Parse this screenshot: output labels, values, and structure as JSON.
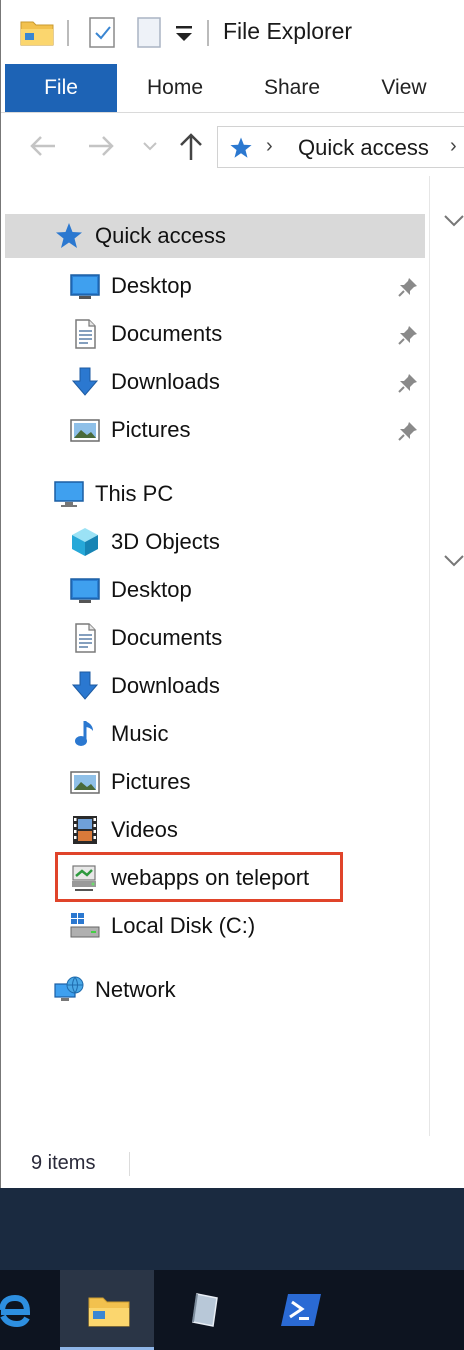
{
  "window": {
    "title": "File Explorer"
  },
  "ribbon": {
    "tabs": [
      {
        "label": "File",
        "active": true
      },
      {
        "label": "Home"
      },
      {
        "label": "Share"
      },
      {
        "label": "View"
      }
    ]
  },
  "address_bar": {
    "location": "Quick access"
  },
  "nav_pane": {
    "quick_access": {
      "label": "Quick access",
      "items": [
        {
          "label": "Desktop",
          "icon": "desktop-icon",
          "pinned": true
        },
        {
          "label": "Documents",
          "icon": "documents-icon",
          "pinned": true
        },
        {
          "label": "Downloads",
          "icon": "downloads-icon",
          "pinned": true
        },
        {
          "label": "Pictures",
          "icon": "pictures-icon",
          "pinned": true
        }
      ]
    },
    "this_pc": {
      "label": "This PC",
      "items": [
        {
          "label": "3D Objects",
          "icon": "3d-objects-icon"
        },
        {
          "label": "Desktop",
          "icon": "desktop-icon"
        },
        {
          "label": "Documents",
          "icon": "documents-icon"
        },
        {
          "label": "Downloads",
          "icon": "downloads-icon"
        },
        {
          "label": "Music",
          "icon": "music-icon"
        },
        {
          "label": "Pictures",
          "icon": "pictures-icon"
        },
        {
          "label": "Videos",
          "icon": "videos-icon"
        },
        {
          "label": "webapps on teleport",
          "icon": "network-drive-icon",
          "highlighted": true
        },
        {
          "label": "Local Disk (C:)",
          "icon": "local-disk-icon"
        }
      ]
    },
    "network": {
      "label": "Network",
      "icon": "network-icon"
    }
  },
  "status_bar": {
    "item_count": "9 items"
  },
  "taskbar": {
    "apps": [
      {
        "icon": "internet-explorer-icon"
      },
      {
        "icon": "file-explorer-icon",
        "active": true
      },
      {
        "icon": "server-manager-icon"
      },
      {
        "icon": "powershell-icon"
      }
    ]
  },
  "colors": {
    "file_tab": "#1d63b5",
    "selection": "#d9d9d9",
    "highlight_box": "#e0442a",
    "taskbar": "#0d1420"
  }
}
